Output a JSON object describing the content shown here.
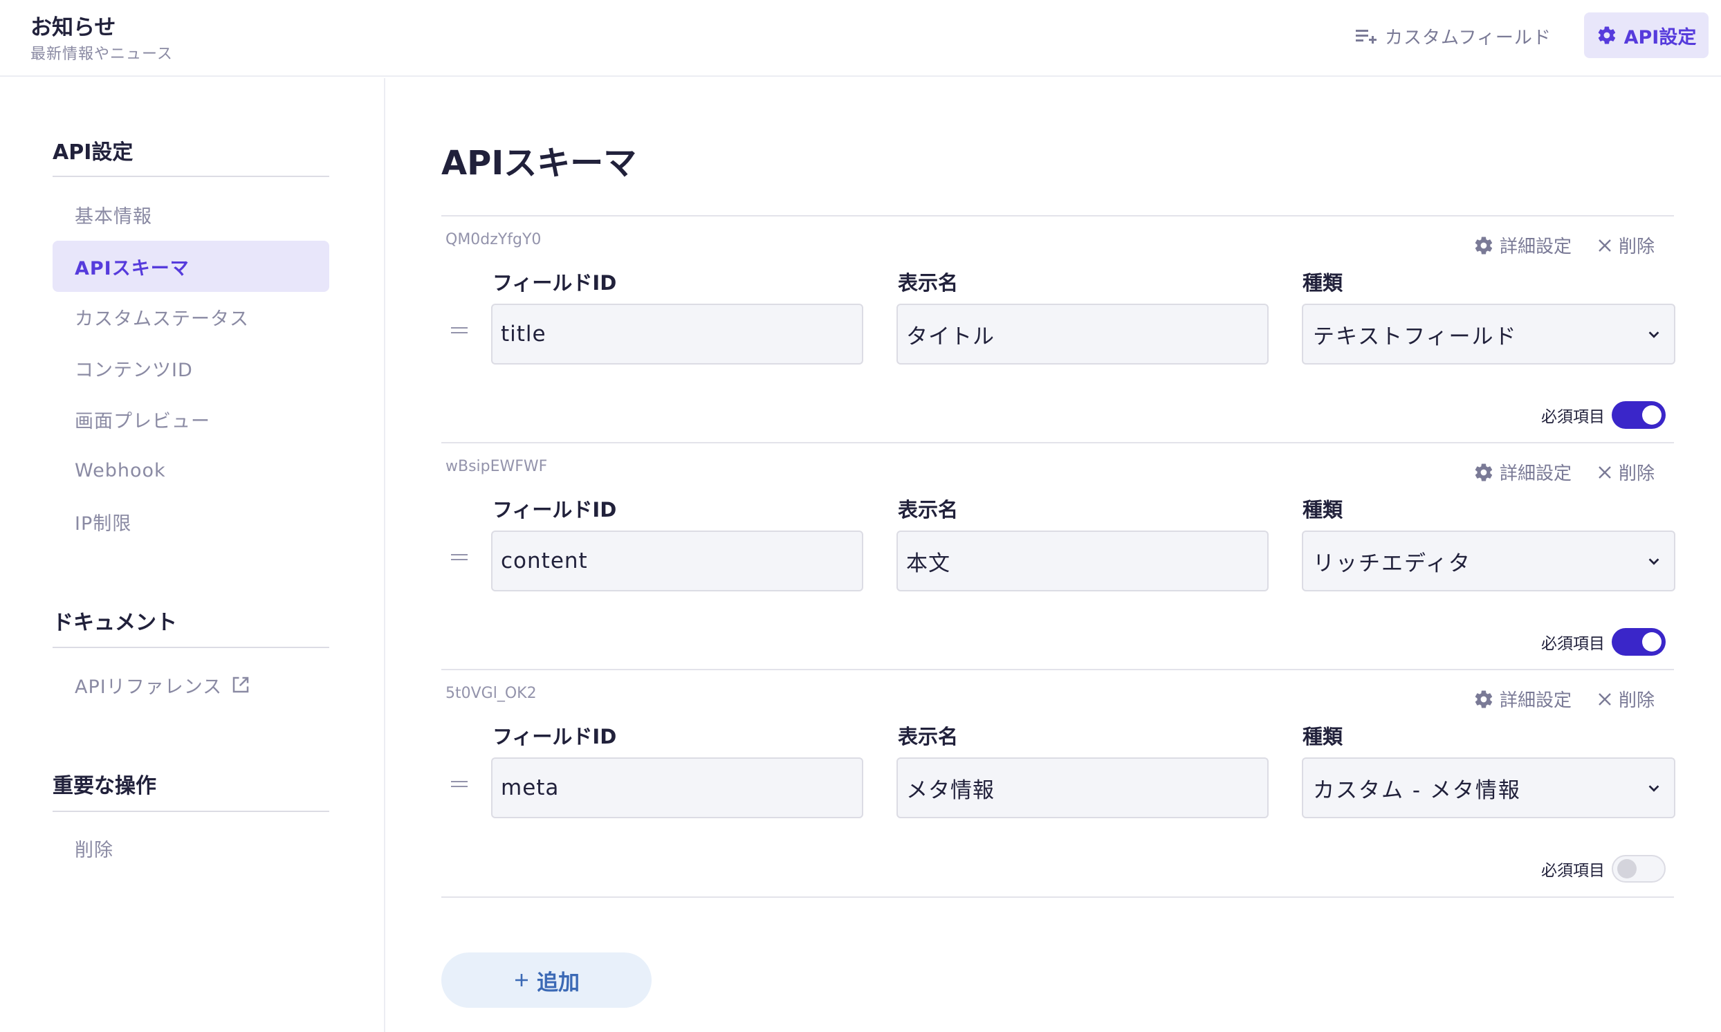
{
  "header": {
    "title": "お知らせ",
    "subtitle": "最新情報やニュース",
    "custom_field_label": "カスタムフィールド",
    "api_settings_label": "API設定"
  },
  "sidebar": {
    "sections": [
      {
        "heading": "API設定",
        "items": [
          {
            "label": "基本情報",
            "active": false
          },
          {
            "label": "APIスキーマ",
            "active": true
          },
          {
            "label": "カスタムステータス",
            "active": false
          },
          {
            "label": "コンテンツID",
            "active": false
          },
          {
            "label": "画面プレビュー",
            "active": false
          },
          {
            "label": "Webhook",
            "active": false
          },
          {
            "label": "IP制限",
            "active": false
          }
        ]
      },
      {
        "heading": "ドキュメント",
        "items": [
          {
            "label": "APIリファレンス",
            "external": true
          }
        ]
      },
      {
        "heading": "重要な操作",
        "items": [
          {
            "label": "削除"
          }
        ]
      }
    ]
  },
  "main": {
    "title": "APIスキーマ",
    "labels": {
      "field_id": "フィールドID",
      "display_name": "表示名",
      "type": "種類",
      "details": "詳細設定",
      "delete": "削除",
      "required": "必須項目"
    },
    "fields": [
      {
        "id": "QM0dzYfgY0",
        "field_id": "title",
        "display_name": "タイトル",
        "type": "テキストフィールド",
        "required": true
      },
      {
        "id": "wBsipEWFWF",
        "field_id": "content",
        "display_name": "本文",
        "type": "リッチエディタ",
        "required": true
      },
      {
        "id": "5t0VGl_OK2",
        "field_id": "meta",
        "display_name": "メタ情報",
        "type": "カスタム - メタ情報",
        "required": false
      }
    ],
    "add_button": "追加"
  },
  "colors": {
    "accent": "#563bdc",
    "toggle_on": "#3a26c9",
    "add_button_bg": "#e8f0fa",
    "add_button_text": "#3b69b5"
  }
}
